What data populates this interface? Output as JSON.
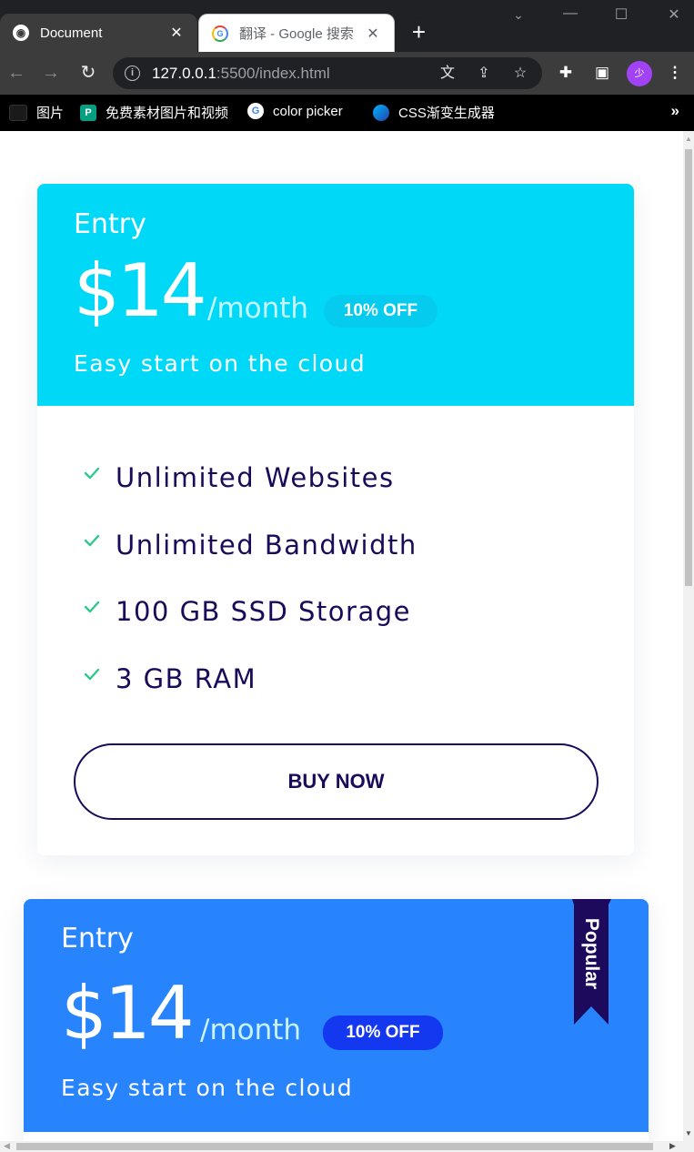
{
  "browser": {
    "tabs": [
      {
        "title": "Document",
        "active": true,
        "favicon": "globe-icon"
      },
      {
        "title": "翻译 - Google 搜索",
        "active": false,
        "favicon": "google-icon"
      }
    ],
    "address": {
      "host": "127.0.0.1",
      "path": ":5500/index.html"
    },
    "profile_initial": "少",
    "bookmarks": [
      {
        "label": "图片",
        "icon": "folder-icon"
      },
      {
        "label": "免费素材图片和视频",
        "icon": "pexels-icon"
      },
      {
        "label": "color picker",
        "icon": "google-icon"
      },
      {
        "label": "CSS渐变生成器",
        "icon": "gradient-icon"
      }
    ],
    "bookmarks_more": "»"
  },
  "cards": [
    {
      "plan": "Entry",
      "price": "$14",
      "period": "/month",
      "discount": "10% OFF",
      "tagline": "Easy start on the cloud",
      "header_color": "#00d8f8",
      "features": [
        "Unlimited Websites",
        "Unlimited Bandwidth",
        "100 GB SSD Storage",
        "3 GB RAM"
      ],
      "cta": "BUY NOW"
    },
    {
      "plan": "Entry",
      "price": "$14",
      "period": "/month",
      "discount": "10% OFF",
      "tagline": "Easy start on the cloud",
      "header_color": "#2784fc",
      "badge": "Popular"
    }
  ],
  "colors": {
    "text_dark": "#1b0a5a",
    "check_green": "#2ec98c",
    "popular_ribbon": "#1e0a5c",
    "discount_popular": "#1438f0"
  }
}
